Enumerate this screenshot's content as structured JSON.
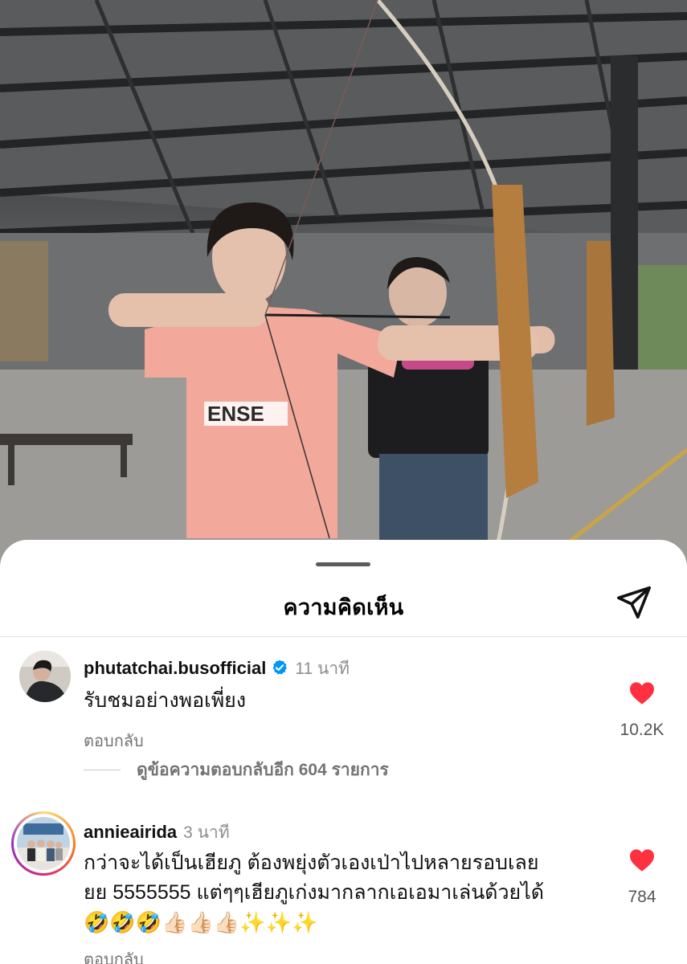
{
  "sheet": {
    "title": "ความคิดเห็น",
    "share_icon": "paper-plane-icon"
  },
  "comments": [
    {
      "username": "phutatchai.busofficial",
      "verified": true,
      "time": "11 นาที",
      "text": "รับชมอย่างพอเพี่ยง",
      "reply_label": "ตอบกลับ",
      "view_replies": "ดูข้อความตอบกลับอีก 604 รายการ",
      "likes": "10.2K"
    },
    {
      "username": "annieairida",
      "verified": false,
      "time": "3 นาที",
      "text_line1": "กว่าจะได้เป็นเฮียภู ต้องพยุ่งตัวเองเป่าไปหลายรอบเลย",
      "text_line2": "ยย 5555555 แต่ๆๆเฮียภูเก่งมากลากเอเอมาเล่นด้วยได้",
      "emoji_line": "🤣🤣🤣👍🏻👍🏻👍🏻✨✨✨",
      "reply_label": "ตอบกลับ",
      "likes": "784"
    }
  ],
  "colors": {
    "heart": "#ff3040",
    "verified": "#0095f6",
    "story_ring": [
      "#feda75",
      "#fa7e1e",
      "#d62976",
      "#962fbf"
    ]
  }
}
